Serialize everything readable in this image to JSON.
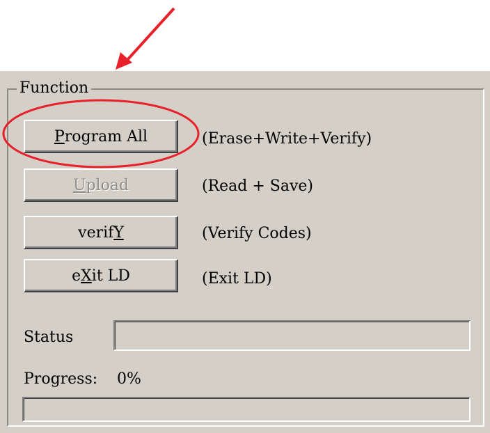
{
  "group": {
    "title": "Function"
  },
  "buttons": [
    {
      "id": "program-all",
      "pre": "",
      "mnemonic": "P",
      "post": "rogram All",
      "description": "(Erase+Write+Verify)",
      "enabled": true
    },
    {
      "id": "upload",
      "pre": "",
      "mnemonic": "U",
      "post": "pload",
      "description": "(Read + Save)",
      "enabled": false
    },
    {
      "id": "verify",
      "pre": "verif",
      "mnemonic": "Y",
      "post": "",
      "description": "(Verify Codes)",
      "enabled": true
    },
    {
      "id": "exit-ld",
      "pre": "e",
      "mnemonic": "X",
      "post": "it LD",
      "description": "(Exit LD)",
      "enabled": true
    }
  ],
  "status": {
    "label": "Status",
    "value": ""
  },
  "progress": {
    "label": "Progress:",
    "percent_text": "0%",
    "fraction": 0
  },
  "annotation": {
    "color": "#e8202a"
  }
}
